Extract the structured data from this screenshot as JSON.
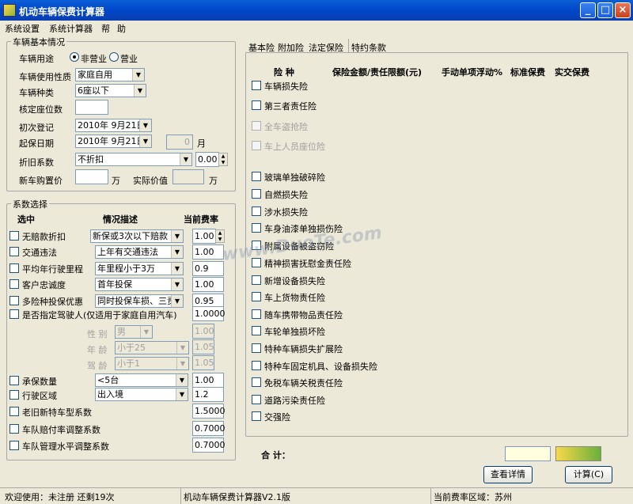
{
  "window": {
    "title": "机动车辆保费计算器"
  },
  "menu": [
    "系统设置",
    "系统计算器",
    "帮",
    "助"
  ],
  "basic": {
    "group_title": "车辆基本情况",
    "usage_label": "车辆用途",
    "usage_opt1": "非营业",
    "usage_opt2": "营业",
    "nature_label": "车辆使用性质",
    "nature_value": "家庭自用",
    "type_label": "车辆种类",
    "type_value": "6座以下",
    "seats_label": "核定座位数",
    "reg_label": "初次登记",
    "reg_value": "2010年 9月21日",
    "start_label": "起保日期",
    "start_value": "2010年 9月21日",
    "month_suffix": "月",
    "month_value": "0",
    "depr_label": "折旧系数",
    "depr_value": "不折扣",
    "depr_num": "0.00",
    "new_price_label": "新车购置价",
    "wan1": "万",
    "actual_label": "实际价值",
    "wan2": "万"
  },
  "coef": {
    "group_title": "系数选择",
    "hdr_select": "选中",
    "hdr_desc": "情况描述",
    "hdr_rate": "当前费率",
    "rows": [
      {
        "label": "无赔款折扣",
        "sel": "新保或3次以下赔款",
        "val": "1.00"
      },
      {
        "label": "交通违法",
        "sel": "上年有交通违法",
        "val": "1.00"
      },
      {
        "label": "平均年行驶里程",
        "sel": "年里程小于3万",
        "val": "0.9"
      },
      {
        "label": "客户忠诚度",
        "sel": "首年投保",
        "val": "1.00"
      },
      {
        "label": "多险种投保优惠",
        "sel": "同时投保车损、三责",
        "val": "0.95"
      }
    ],
    "driver_label": "是否指定驾驶人(仅适用于家庭自用汽车)",
    "driver_val": "1.0000",
    "gender_label": "性  别",
    "gender_sel": "男",
    "gender_val": "1.00",
    "age_label": "年  龄",
    "age_sel": "小于25",
    "age_val": "1.05",
    "drive_age_label": "驾  龄",
    "drive_age_sel": "小于1",
    "drive_age_val": "1.05",
    "qty_label": "承保数量",
    "qty_sel": "<5台",
    "qty_val": "1.00",
    "area_label": "行驶区域",
    "area_sel": "出入境",
    "area_val": "1.2",
    "old_label": "老旧新特车型系数",
    "old_val": "1.5000",
    "fleet_label": "车队赔付率调整系数",
    "fleet_val": "0.7000",
    "mgmt_label": "车队管理水平调整系数",
    "mgmt_val": "0.7000"
  },
  "tabs": [
    "基本险",
    "附加险",
    "法定保险",
    "特约条款"
  ],
  "table": {
    "h_type": "险  种",
    "h_amount": "保险金额/责任限额(元)",
    "h_float": "手动单项浮动%",
    "h_std": "标准保费",
    "h_actual": "实交保费"
  },
  "items": [
    {
      "label": "车辆损失险",
      "enabled": true
    },
    {
      "label": "第三者责任险",
      "enabled": true
    },
    {
      "label": "全车盗抢险",
      "enabled": false
    },
    {
      "label": "车上人员座位险",
      "enabled": false
    },
    {
      "label": "玻璃单独破碎险",
      "enabled": true
    },
    {
      "label": "自燃损失险",
      "enabled": true
    },
    {
      "label": "涉水损失险",
      "enabled": true
    },
    {
      "label": "车身油漆单独损伤险",
      "enabled": true
    },
    {
      "label": "附属设备被盗窃险",
      "enabled": true
    },
    {
      "label": "精神损害抚慰金责任险",
      "enabled": true
    },
    {
      "label": "新增设备损失险",
      "enabled": true
    },
    {
      "label": "车上货物责任险",
      "enabled": true
    },
    {
      "label": "随车携带物品责任险",
      "enabled": true
    },
    {
      "label": "车轮单独损坏险",
      "enabled": true
    },
    {
      "label": "特种车辆损失扩展险",
      "enabled": true
    },
    {
      "label": "特种车固定机具、设备损失险",
      "enabled": true
    },
    {
      "label": "免税车辆关税责任险",
      "enabled": true
    },
    {
      "label": "道路污染责任险",
      "enabled": true
    },
    {
      "label": "交强险",
      "enabled": true
    }
  ],
  "total_label": "合  计：",
  "buttons": {
    "detail": "查看详情",
    "calc": "计算(C)"
  },
  "status": {
    "welcome": "欢迎使用：未注册   还剩19次",
    "version": "机动车辆保费计算器V2.1版",
    "region": "当前费率区域：苏州"
  },
  "watermark": "www.DuoTe.com"
}
